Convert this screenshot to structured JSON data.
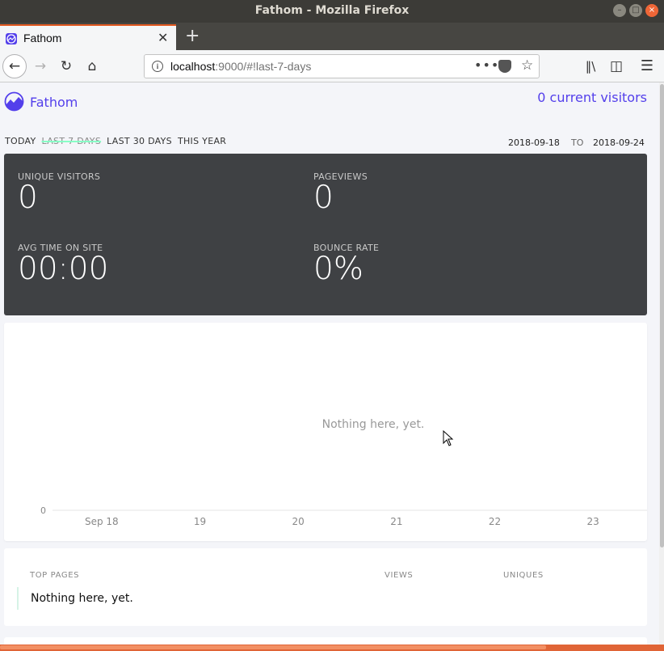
{
  "window": {
    "title": "Fathom - Mozilla Firefox"
  },
  "browser": {
    "tab_title": "Fathom",
    "new_tab_symbol": "+",
    "url_host": "localhost",
    "url_rest": ":9000/#!last-7-days"
  },
  "header": {
    "brand": "Fathom",
    "realtime": "0 current visitors"
  },
  "ranges": {
    "today": "TODAY",
    "last7": "LAST 7 DAYS",
    "last30": "LAST 30 DAYS",
    "year": "THIS YEAR",
    "active": "LAST 7 DAYS"
  },
  "dates": {
    "start": "2018-09-18",
    "to": "TO",
    "end": "2018-09-24"
  },
  "totals": {
    "unique_label": "UNIQUE VISITORS",
    "unique_value": "0",
    "pageviews_label": "PAGEVIEWS",
    "pageviews_value": "0",
    "avgtime_label": "AVG TIME ON SITE",
    "avgtime_value": "00:00",
    "bounce_label": "BOUNCE RATE",
    "bounce_value": "0%"
  },
  "chart_data": {
    "type": "line",
    "categories": [
      "Sep 18",
      "19",
      "20",
      "21",
      "22",
      "23"
    ],
    "series": [
      {
        "values": [
          0,
          0,
          0,
          0,
          0,
          0
        ]
      }
    ],
    "yticks": [
      "0"
    ],
    "empty_message": "Nothing here, yet.",
    "ylim": [
      0,
      1
    ]
  },
  "top_pages": {
    "col_pages": "TOP PAGES",
    "col_views": "VIEWS",
    "col_uniques": "UNIQUES",
    "empty": "Nothing here, yet."
  },
  "colors": {
    "brand": "#533feb",
    "totals_bg": "#3f4144",
    "active_range_underline": "#88ffc6"
  }
}
